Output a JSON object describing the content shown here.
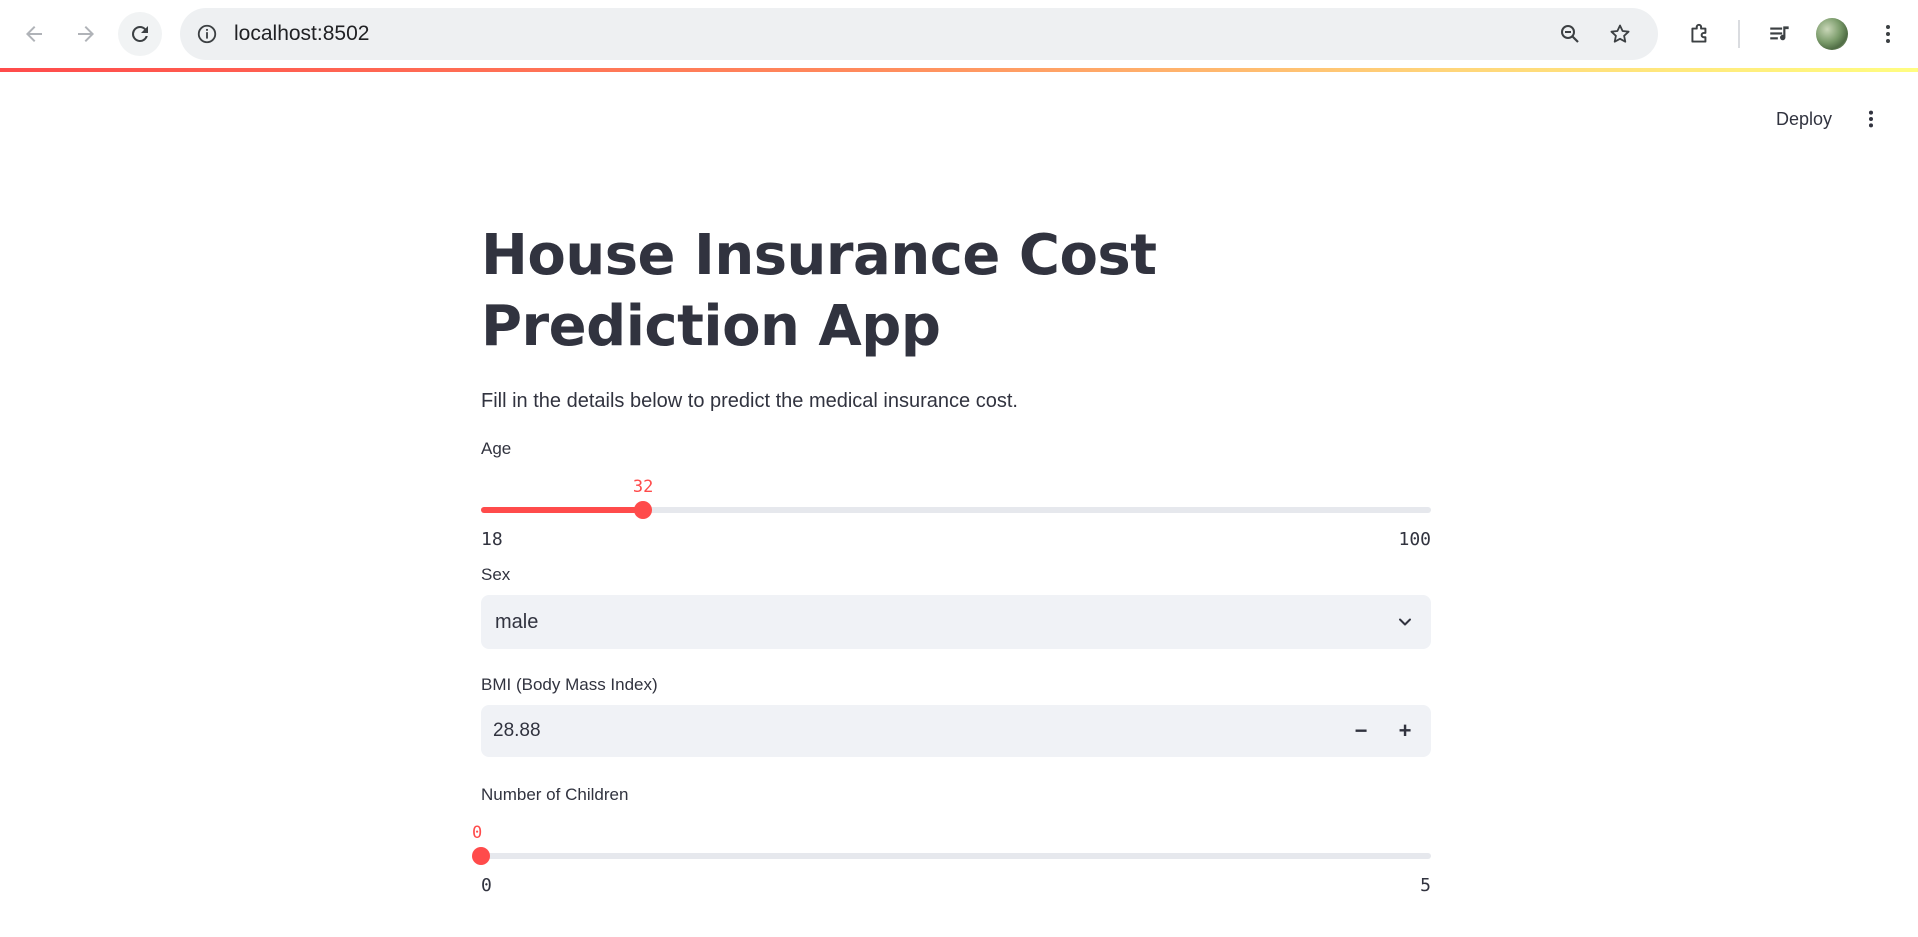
{
  "browser": {
    "url": "localhost:8502"
  },
  "header": {
    "deploy_label": "Deploy"
  },
  "main": {
    "title": "House Insurance Cost Prediction App",
    "subtitle": "Fill in the details below to predict the medical insurance cost.",
    "age": {
      "label": "Age",
      "value": "32",
      "min": "18",
      "max": "100",
      "fraction": 0.1707
    },
    "sex": {
      "label": "Sex",
      "value": "male"
    },
    "bmi": {
      "label": "BMI (Body Mass Index)",
      "value": "28.88",
      "minus": "−",
      "plus": "+"
    },
    "children": {
      "label": "Number of Children",
      "value": "0",
      "min": "0",
      "max": "5",
      "fraction": 0
    }
  },
  "colors": {
    "accent": "#ff4b4b",
    "text": "#31333f",
    "input_bg": "#f0f2f6"
  },
  "icons": [
    "back-arrow-icon",
    "forward-arrow-icon",
    "reload-icon",
    "site-info-icon",
    "zoom-icon",
    "star-icon",
    "extensions-icon",
    "media-icon",
    "profile-avatar",
    "browser-menu-icon",
    "streamlit-menu-icon",
    "chevron-down-icon"
  ]
}
